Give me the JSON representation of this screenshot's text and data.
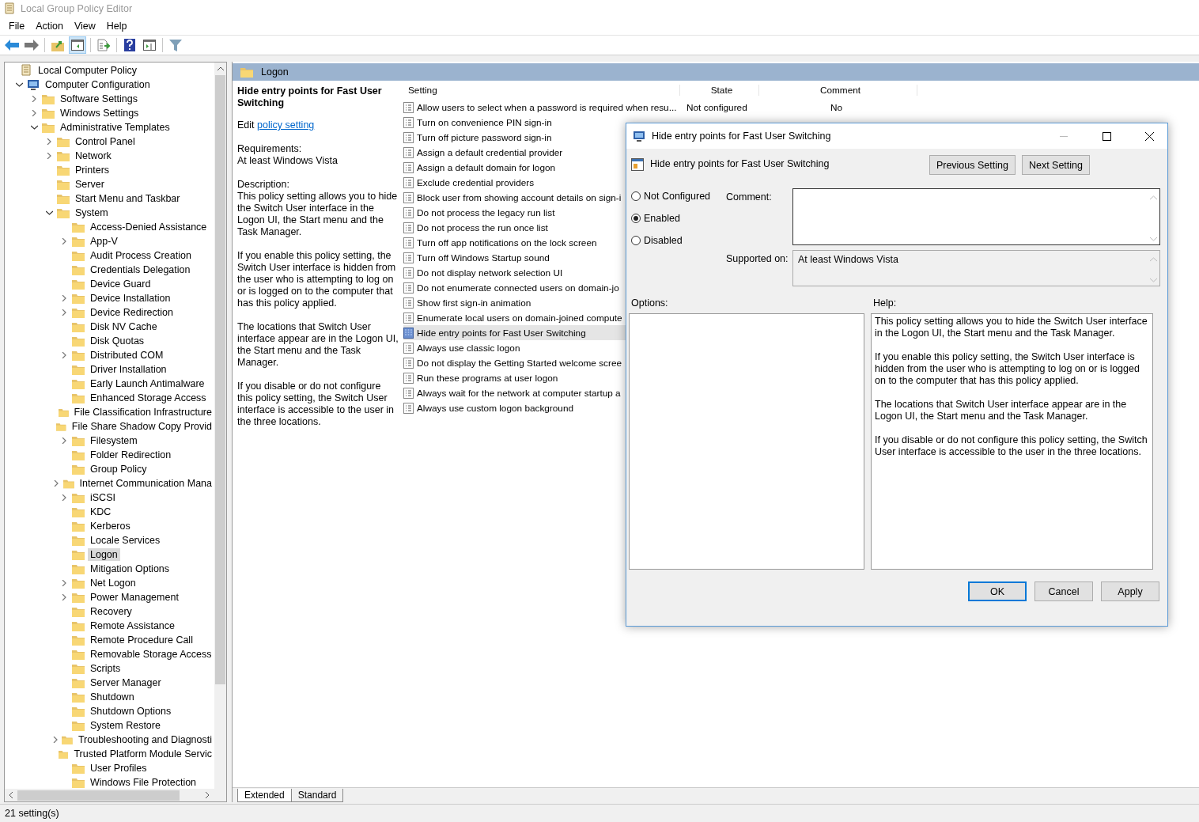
{
  "window": {
    "title": "Local Group Policy Editor"
  },
  "menu": [
    "File",
    "Action",
    "View",
    "Help"
  ],
  "toolbar": [
    {
      "kind": "back",
      "pressed": false
    },
    {
      "kind": "forward",
      "pressed": false
    },
    {
      "kind": "sep"
    },
    {
      "kind": "up",
      "pressed": false
    },
    {
      "kind": "tree",
      "pressed": true
    },
    {
      "kind": "sep"
    },
    {
      "kind": "export",
      "pressed": false
    },
    {
      "kind": "sep"
    },
    {
      "kind": "help",
      "pressed": false
    },
    {
      "kind": "pane",
      "pressed": false
    },
    {
      "kind": "sep"
    },
    {
      "kind": "filter",
      "pressed": false
    }
  ],
  "tree": [
    {
      "label": "Local Computer Policy",
      "kind": "root",
      "selected": false,
      "children": [
        {
          "label": "Computer Configuration",
          "kind": "expanded",
          "selected": false,
          "children": [
            {
              "label": "Software Settings",
              "kind": "collapsed",
              "selected": false
            },
            {
              "label": "Windows Settings",
              "kind": "collapsed",
              "selected": false
            },
            {
              "label": "Administrative Templates",
              "kind": "expanded",
              "selected": false,
              "children": [
                {
                  "label": "Control Panel",
                  "kind": "collapsed",
                  "selected": false
                },
                {
                  "label": "Network",
                  "kind": "collapsed",
                  "selected": false
                },
                {
                  "label": "Printers",
                  "kind": "leaf",
                  "selected": false
                },
                {
                  "label": "Server",
                  "kind": "leaf",
                  "selected": false
                },
                {
                  "label": "Start Menu and Taskbar",
                  "kind": "leaf",
                  "selected": false
                },
                {
                  "label": "System",
                  "kind": "expanded",
                  "selected": false,
                  "children": [
                    {
                      "label": "Access-Denied Assistance",
                      "kind": "leaf",
                      "selected": false
                    },
                    {
                      "label": "App-V",
                      "kind": "collapsed",
                      "selected": false
                    },
                    {
                      "label": "Audit Process Creation",
                      "kind": "leaf",
                      "selected": false
                    },
                    {
                      "label": "Credentials Delegation",
                      "kind": "leaf",
                      "selected": false
                    },
                    {
                      "label": "Device Guard",
                      "kind": "leaf",
                      "selected": false
                    },
                    {
                      "label": "Device Installation",
                      "kind": "collapsed",
                      "selected": false
                    },
                    {
                      "label": "Device Redirection",
                      "kind": "collapsed",
                      "selected": false
                    },
                    {
                      "label": "Disk NV Cache",
                      "kind": "leaf",
                      "selected": false
                    },
                    {
                      "label": "Disk Quotas",
                      "kind": "leaf",
                      "selected": false
                    },
                    {
                      "label": "Distributed COM",
                      "kind": "collapsed",
                      "selected": false
                    },
                    {
                      "label": "Driver Installation",
                      "kind": "leaf",
                      "selected": false
                    },
                    {
                      "label": "Early Launch Antimalware",
                      "kind": "leaf",
                      "selected": false
                    },
                    {
                      "label": "Enhanced Storage Access",
                      "kind": "leaf",
                      "selected": false
                    },
                    {
                      "label": "File Classification Infrastructure",
                      "kind": "leaf",
                      "selected": false
                    },
                    {
                      "label": "File Share Shadow Copy Provid",
                      "kind": "leaf",
                      "selected": false
                    },
                    {
                      "label": "Filesystem",
                      "kind": "collapsed",
                      "selected": false
                    },
                    {
                      "label": "Folder Redirection",
                      "kind": "leaf",
                      "selected": false
                    },
                    {
                      "label": "Group Policy",
                      "kind": "leaf",
                      "selected": false
                    },
                    {
                      "label": "Internet Communication Mana",
                      "kind": "collapsed",
                      "selected": false
                    },
                    {
                      "label": "iSCSI",
                      "kind": "collapsed",
                      "selected": false
                    },
                    {
                      "label": "KDC",
                      "kind": "leaf",
                      "selected": false
                    },
                    {
                      "label": "Kerberos",
                      "kind": "leaf",
                      "selected": false
                    },
                    {
                      "label": "Locale Services",
                      "kind": "leaf",
                      "selected": false
                    },
                    {
                      "label": "Logon",
                      "kind": "leaf",
                      "selected": true
                    },
                    {
                      "label": "Mitigation Options",
                      "kind": "leaf",
                      "selected": false
                    },
                    {
                      "label": "Net Logon",
                      "kind": "collapsed",
                      "selected": false
                    },
                    {
                      "label": "Power Management",
                      "kind": "collapsed",
                      "selected": false
                    },
                    {
                      "label": "Recovery",
                      "kind": "leaf",
                      "selected": false
                    },
                    {
                      "label": "Remote Assistance",
                      "kind": "leaf",
                      "selected": false
                    },
                    {
                      "label": "Remote Procedure Call",
                      "kind": "leaf",
                      "selected": false
                    },
                    {
                      "label": "Removable Storage Access",
                      "kind": "leaf",
                      "selected": false
                    },
                    {
                      "label": "Scripts",
                      "kind": "leaf",
                      "selected": false
                    },
                    {
                      "label": "Server Manager",
                      "kind": "leaf",
                      "selected": false
                    },
                    {
                      "label": "Shutdown",
                      "kind": "leaf",
                      "selected": false
                    },
                    {
                      "label": "Shutdown Options",
                      "kind": "leaf",
                      "selected": false
                    },
                    {
                      "label": "System Restore",
                      "kind": "leaf",
                      "selected": false
                    },
                    {
                      "label": "Troubleshooting and Diagnosti",
                      "kind": "collapsed",
                      "selected": false
                    },
                    {
                      "label": "Trusted Platform Module Servic",
                      "kind": "leaf",
                      "selected": false
                    },
                    {
                      "label": "User Profiles",
                      "kind": "leaf",
                      "selected": false
                    },
                    {
                      "label": "Windows File Protection",
                      "kind": "leaf",
                      "selected": false
                    }
                  ]
                }
              ]
            }
          ]
        }
      ]
    }
  ],
  "details": {
    "header": "Logon",
    "title": "Hide entry points for Fast User Switching",
    "edit_prefix": "Edit",
    "edit_link": "policy setting",
    "requirements_label": "Requirements:",
    "requirements": "At least Windows Vista",
    "description_label": "Description:",
    "paragraphs": [
      "This policy setting allows you to hide the Switch User interface in the Logon UI, the Start menu and the Task Manager.",
      "If you enable this policy setting, the Switch User interface is hidden from the user who is attempting to log on or is logged on to the computer that has this policy applied.",
      "The locations that Switch User interface appear are in the Logon UI, the Start menu and the Task Manager.",
      "If you disable or do not configure this policy setting, the Switch User interface is accessible to the user in the three locations."
    ]
  },
  "settings": {
    "columns": [
      "Setting",
      "State",
      "Comment"
    ],
    "rows": [
      {
        "name": "Allow users to select when a password is required when resu...",
        "state": "Not configured",
        "comment": "No",
        "selected": false
      },
      {
        "name": "Turn on convenience PIN sign-in",
        "selected": false
      },
      {
        "name": "Turn off picture password sign-in",
        "selected": false
      },
      {
        "name": "Assign a default credential provider",
        "selected": false
      },
      {
        "name": "Assign a default domain for logon",
        "selected": false
      },
      {
        "name": "Exclude credential providers",
        "selected": false
      },
      {
        "name": "Block user from showing account details on sign-i",
        "selected": false
      },
      {
        "name": "Do not process the legacy run list",
        "selected": false
      },
      {
        "name": "Do not process the run once list",
        "selected": false
      },
      {
        "name": "Turn off app notifications on the lock screen",
        "selected": false
      },
      {
        "name": "Turn off Windows Startup sound",
        "selected": false
      },
      {
        "name": "Do not display network selection UI",
        "selected": false
      },
      {
        "name": "Do not enumerate connected users on domain-jo",
        "selected": false
      },
      {
        "name": "Show first sign-in animation",
        "selected": false
      },
      {
        "name": "Enumerate local users on domain-joined compute",
        "selected": false
      },
      {
        "name": "Hide entry points for Fast User Switching",
        "selected": true
      },
      {
        "name": "Always use classic logon",
        "selected": false
      },
      {
        "name": "Do not display the Getting Started welcome scree",
        "selected": false
      },
      {
        "name": "Run these programs at user logon",
        "selected": false
      },
      {
        "name": "Always wait for the network at computer startup a",
        "selected": false
      },
      {
        "name": "Always use custom logon background",
        "selected": false
      }
    ]
  },
  "view_tabs": [
    {
      "label": "Extended",
      "selected": true
    },
    {
      "label": "Standard",
      "selected": false
    }
  ],
  "status_bar": "21 setting(s)",
  "dialog": {
    "title": "Hide entry points for Fast User Switching",
    "heading": "Hide entry points for Fast User Switching",
    "nav_buttons": [
      "Previous Setting",
      "Next Setting"
    ],
    "options": [
      {
        "label": "Not Configured",
        "selected": false
      },
      {
        "label": "Enabled",
        "selected": true
      },
      {
        "label": "Disabled",
        "selected": false
      }
    ],
    "comment_label": "Comment:",
    "supported_label": "Supported on:",
    "supported": "At least Windows Vista",
    "options_label": "Options:",
    "help_label": "Help:",
    "help": [
      "This policy setting allows you to hide the Switch User interface in the Logon UI, the Start menu and the Task Manager.",
      "If you enable this policy setting, the Switch User interface is hidden from the user who is attempting to log on or is logged on to the computer that has this policy applied.",
      "The locations that Switch User interface appear are in the Logon UI, the Start menu and the Task Manager.",
      "If you disable or do not configure this policy setting, the Switch User interface is accessible to the user in the three locations."
    ],
    "buttons": [
      {
        "label": "OK",
        "default": true
      },
      {
        "label": "Cancel",
        "default": false
      },
      {
        "label": "Apply",
        "default": false
      }
    ]
  }
}
